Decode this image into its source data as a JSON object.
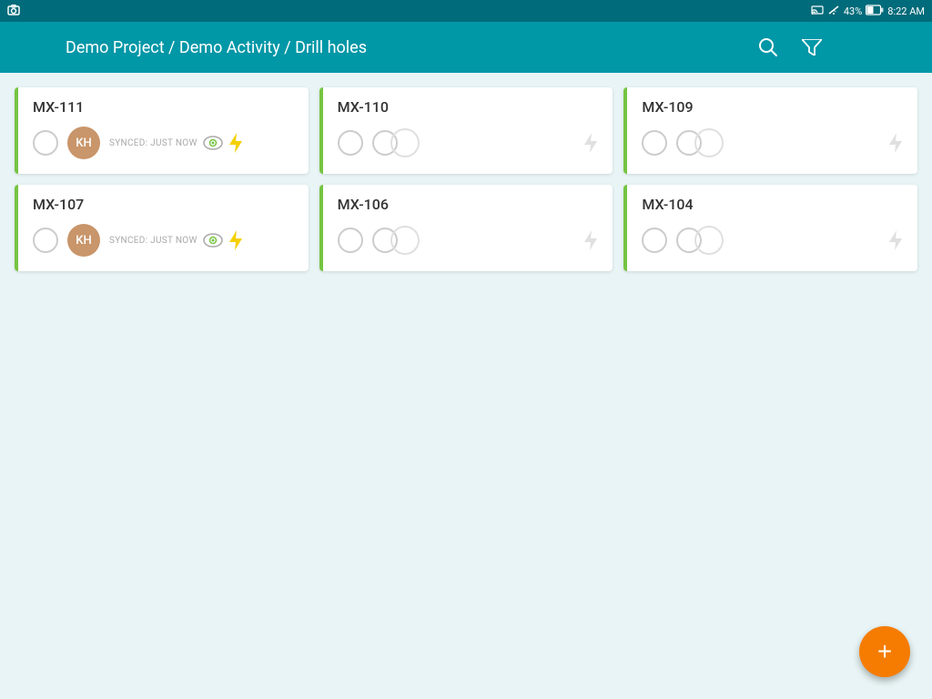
{
  "statusBar": {
    "battery": "43%",
    "time": "8:22 AM"
  },
  "appBar": {
    "menuIcon": "menu-icon",
    "title": "Demo Project / Demo Activity / Drill holes",
    "searchIcon": "search-icon",
    "filterIcon": "filter-icon",
    "flashIcon": "flash-icon",
    "moreIcon": "more-icon"
  },
  "cards": [
    {
      "id": "MX-111",
      "hasAvatar": true,
      "avatarText": "KH",
      "syncText": "SYNCED: JUST NOW",
      "hasSyncIcon": true,
      "hasActiveLightning": true,
      "borderColor": "#76c442"
    },
    {
      "id": "MX-110",
      "hasAvatar": false,
      "syncText": "",
      "hasSyncIcon": false,
      "hasActiveLightning": false,
      "borderColor": "#76c442"
    },
    {
      "id": "MX-109",
      "hasAvatar": false,
      "syncText": "",
      "hasSyncIcon": false,
      "hasActiveLightning": false,
      "borderColor": "#76c442"
    },
    {
      "id": "MX-107",
      "hasAvatar": true,
      "avatarText": "KH",
      "syncText": "SYNCED: JUST NOW",
      "hasSyncIcon": true,
      "hasActiveLightning": true,
      "borderColor": "#76c442"
    },
    {
      "id": "MX-106",
      "hasAvatar": false,
      "syncText": "",
      "hasSyncIcon": false,
      "hasActiveLightning": false,
      "borderColor": "#76c442"
    },
    {
      "id": "MX-104",
      "hasAvatar": false,
      "syncText": "",
      "hasSyncIcon": false,
      "hasActiveLightning": false,
      "borderColor": "#76c442"
    }
  ],
  "fab": {
    "label": "+"
  }
}
